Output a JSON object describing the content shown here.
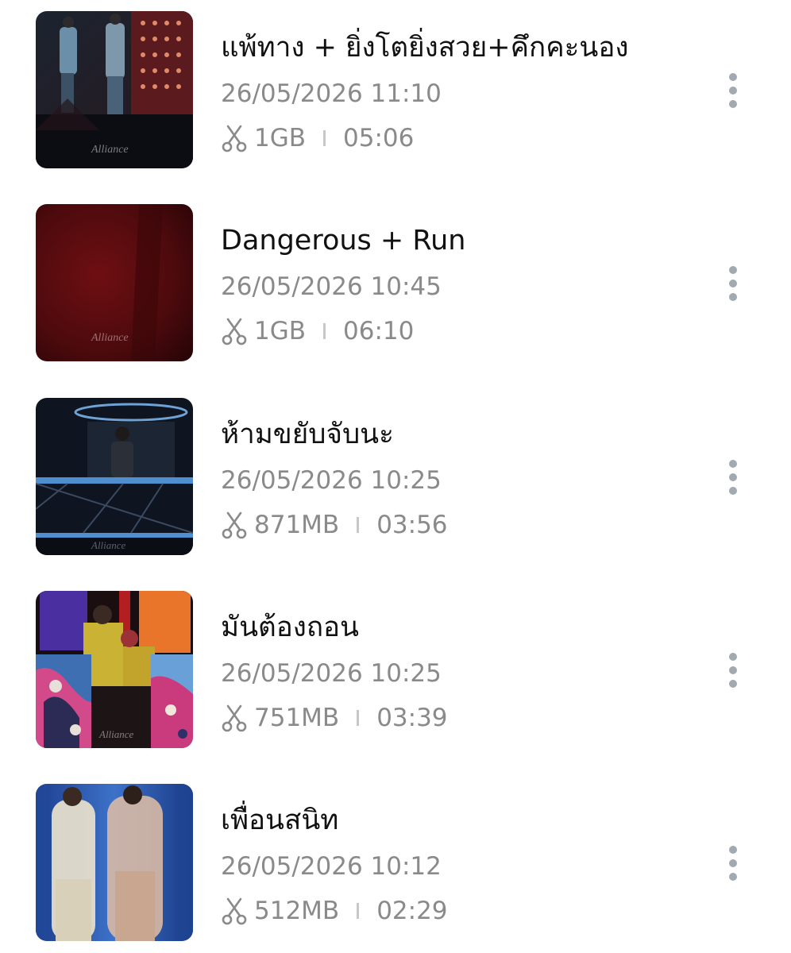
{
  "videos": [
    {
      "title": "แพ้ทาง + ยิ่งโตยิ่งสวย+คึกคะนอง",
      "date": "26/05/2026 11:10",
      "size": "1GB",
      "duration": "05:06",
      "thumbnail_icon": "concert-stage-thumbnail"
    },
    {
      "title": "Dangerous + Run",
      "date": "26/05/2026 10:45",
      "size": "1GB",
      "duration": "06:10",
      "thumbnail_icon": "red-stage-thumbnail"
    },
    {
      "title": "ห้ามขยับจับนะ",
      "date": "26/05/2026 10:25",
      "size": "871MB",
      "duration": "03:56",
      "thumbnail_icon": "stage-platform-thumbnail"
    },
    {
      "title": "มันต้องถอน",
      "date": "26/05/2026 10:25",
      "size": "751MB",
      "duration": "03:39",
      "thumbnail_icon": "dancers-thumbnail"
    },
    {
      "title": "เพื่อนสนิท",
      "date": "26/05/2026 10:12",
      "size": "512MB",
      "duration": "02:29",
      "thumbnail_icon": "performers-blue-thumbnail"
    }
  ],
  "icons": {
    "clip": "scissors-icon",
    "more": "more-vertical-icon"
  },
  "colors": {
    "title": "#111111",
    "secondary_text": "#8a8a8a",
    "more_dots": "#a3a9b1"
  }
}
